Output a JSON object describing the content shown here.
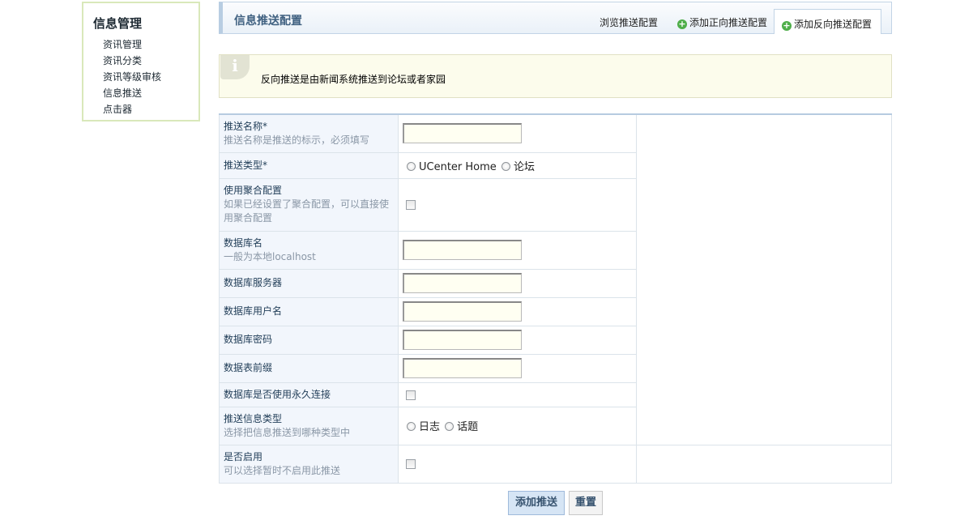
{
  "sidebar": {
    "title": "信息管理",
    "items": [
      {
        "label": "资讯管理"
      },
      {
        "label": "资讯分类"
      },
      {
        "label": "资讯等级审核"
      },
      {
        "label": "信息推送"
      },
      {
        "label": "点击器"
      }
    ]
  },
  "header": {
    "title": "信息推送配置",
    "tabs": [
      {
        "label": "浏览推送配置",
        "icon": null
      },
      {
        "label": "添加正向推送配置",
        "icon": "plus-circle-icon"
      },
      {
        "label": "添加反向推送配置",
        "icon": "plus-circle-icon",
        "active": true
      }
    ]
  },
  "info": {
    "icon": "info-icon",
    "text": "反向推送是由新闻系统推送到论坛或者家园"
  },
  "form": {
    "push_name": {
      "label": "推送名称*",
      "desc": "推送名称是推送的标示，必须填写",
      "value": ""
    },
    "push_type": {
      "label": "推送类型*",
      "options": [
        "UCenter Home",
        "论坛"
      ]
    },
    "use_aggregate": {
      "label": "使用聚合配置",
      "desc": "如果已经设置了聚合配置，可以直接使用聚合配置",
      "checked": false
    },
    "db_name": {
      "label": "数据库名",
      "desc": "一般为本地localhost",
      "value": ""
    },
    "db_server": {
      "label": "数据库服务器",
      "value": ""
    },
    "db_user": {
      "label": "数据库用户名",
      "value": ""
    },
    "db_password": {
      "label": "数据库密码",
      "value": ""
    },
    "table_prefix": {
      "label": "数据表前缀",
      "value": ""
    },
    "persistent": {
      "label": "数据库是否使用永久连接",
      "checked": false
    },
    "info_type": {
      "label": "推送信息类型",
      "desc": "选择把信息推送到哪种类型中",
      "options": [
        "日志",
        "话题"
      ]
    },
    "enabled": {
      "label": "是否启用",
      "desc": "可以选择暂时不启用此推送",
      "checked": false
    }
  },
  "buttons": {
    "submit": "添加推送",
    "reset": "重置"
  },
  "colors": {
    "sidebar_border": "#d9e8ba",
    "header_text": "#3f6080",
    "label_bg": "#f2f6fc",
    "info_bg": "#fcfcec",
    "input_bg": "#fffff2",
    "accent_green": "#4fae4a"
  }
}
